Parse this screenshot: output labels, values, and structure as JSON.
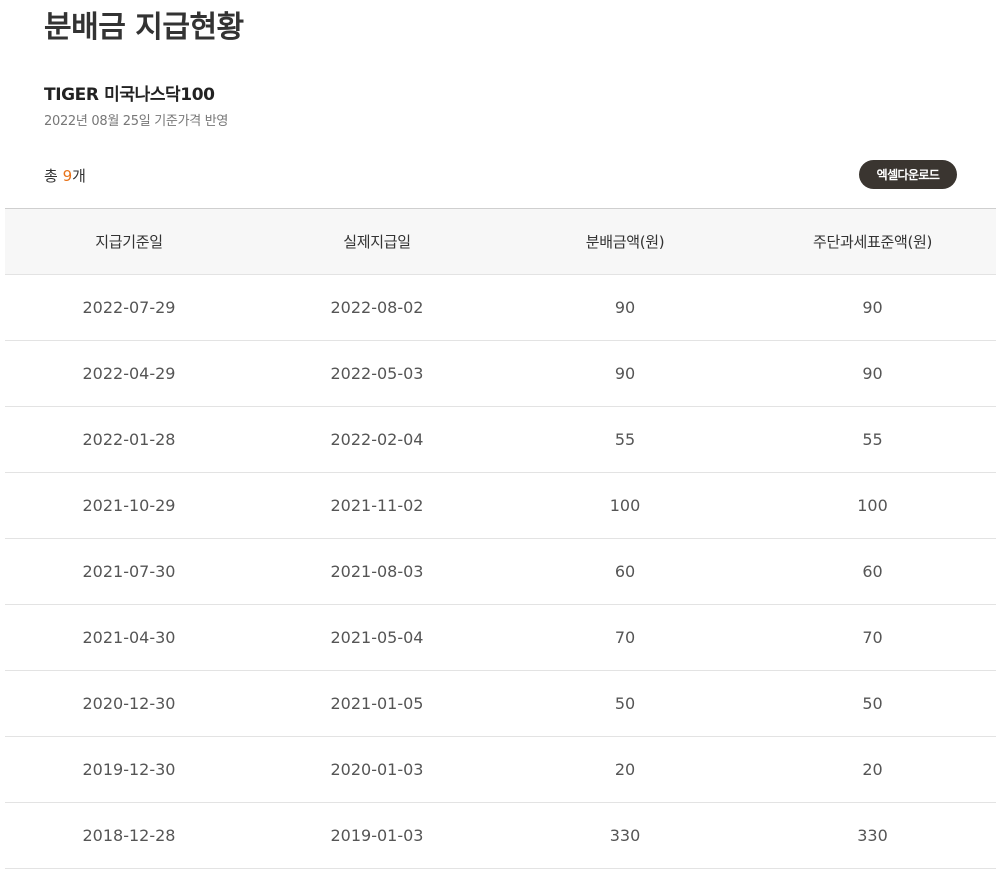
{
  "page": {
    "title": "분배금 지급현황"
  },
  "fund": {
    "name": "TIGER 미국나스닥100",
    "base_date": "2022년 08월 25일 기준가격 반영"
  },
  "summary": {
    "prefix": "총 ",
    "count": "9",
    "suffix": "개"
  },
  "toolbar": {
    "excel_label": "엑셀다운로드"
  },
  "table": {
    "columns": [
      "지급기준일",
      "실제지급일",
      "분배금액(원)",
      "주단과세표준액(원)"
    ],
    "rows": [
      [
        "2022-07-29",
        "2022-08-02",
        "90",
        "90"
      ],
      [
        "2022-04-29",
        "2022-05-03",
        "90",
        "90"
      ],
      [
        "2022-01-28",
        "2022-02-04",
        "55",
        "55"
      ],
      [
        "2021-10-29",
        "2021-11-02",
        "100",
        "100"
      ],
      [
        "2021-07-30",
        "2021-08-03",
        "60",
        "60"
      ],
      [
        "2021-04-30",
        "2021-05-04",
        "70",
        "70"
      ],
      [
        "2020-12-30",
        "2021-01-05",
        "50",
        "50"
      ],
      [
        "2019-12-30",
        "2020-01-03",
        "20",
        "20"
      ],
      [
        "2018-12-28",
        "2019-01-03",
        "330",
        "330"
      ]
    ]
  },
  "colors": {
    "accent": "#e8731a",
    "button_bg": "#3a3530",
    "header_bg": "#f7f7f7"
  }
}
